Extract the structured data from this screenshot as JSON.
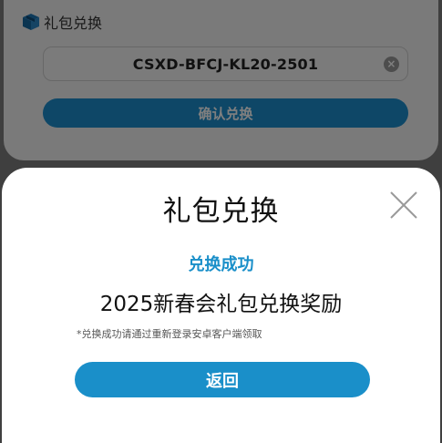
{
  "background": {
    "header_icon": "gift-box-icon",
    "header_title": "礼包兑换",
    "code_value": "CSXD-BFCJ-KL20-2501",
    "clear_icon": "clear-icon",
    "confirm_label": "确认兑换"
  },
  "modal": {
    "title": "礼包兑换",
    "close_icon": "close-icon",
    "status": "兑换成功",
    "reward_name": "2025新春会礼包兑换奖励",
    "hint": "*兑换成功请通过重新登录安卓客户端领取",
    "return_label": "返回"
  },
  "colors": {
    "accent": "#1a8fc9",
    "overlay": "rgba(0,0,0,0.5)"
  }
}
